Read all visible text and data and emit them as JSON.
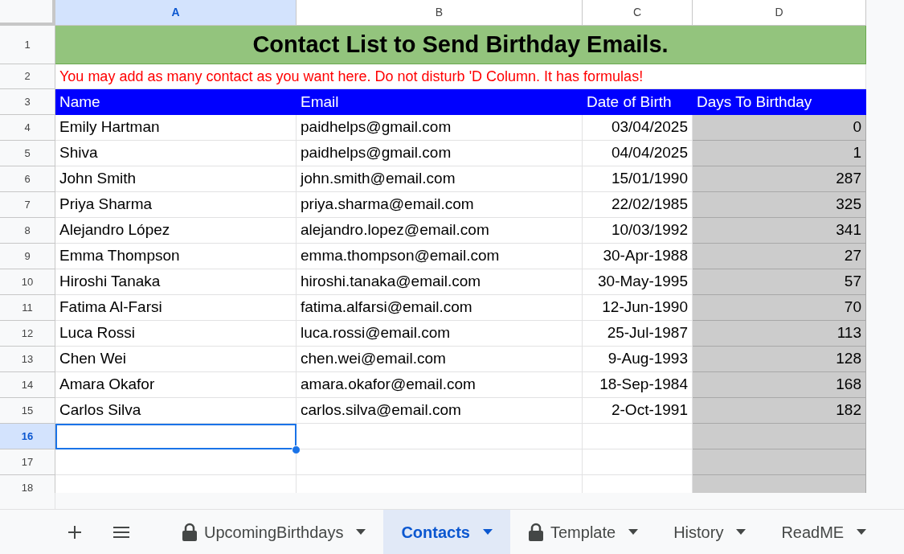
{
  "columns": [
    {
      "label": "A",
      "selected": true
    },
    {
      "label": "B",
      "selected": false
    },
    {
      "label": "C",
      "selected": false
    },
    {
      "label": "D",
      "selected": false
    }
  ],
  "title_row": {
    "number": "1",
    "text": "Contact List to Send Birthday Emails."
  },
  "note_row": {
    "number": "2",
    "text": "You may add as many contact as you want here. Do not disturb 'D Column. It has formulas!"
  },
  "header_row": {
    "number": "3",
    "cells": [
      "Name",
      "Email",
      "Date of Birth",
      "Days To Birthday"
    ]
  },
  "rows": [
    {
      "number": "4",
      "selected": false,
      "cells": [
        "Emily Hartman",
        "paidhelps@gmail.com",
        "03/04/2025",
        "0"
      ]
    },
    {
      "number": "5",
      "selected": false,
      "cells": [
        "Shiva",
        "paidhelps@gmail.com",
        "04/04/2025",
        "1"
      ]
    },
    {
      "number": "6",
      "selected": false,
      "cells": [
        "John Smith",
        "john.smith@email.com",
        "15/01/1990",
        "287"
      ]
    },
    {
      "number": "7",
      "selected": false,
      "cells": [
        "Priya Sharma",
        "priya.sharma@email.com",
        "22/02/1985",
        "325"
      ]
    },
    {
      "number": "8",
      "selected": false,
      "cells": [
        "Alejandro López",
        "alejandro.lopez@email.com",
        "10/03/1992",
        "341"
      ]
    },
    {
      "number": "9",
      "selected": false,
      "cells": [
        "Emma Thompson",
        "emma.thompson@email.com",
        "30-Apr-1988",
        "27"
      ]
    },
    {
      "number": "10",
      "selected": false,
      "cells": [
        "Hiroshi Tanaka",
        "hiroshi.tanaka@email.com",
        "30-May-1995",
        "57"
      ]
    },
    {
      "number": "11",
      "selected": false,
      "cells": [
        "Fatima Al-Farsi",
        "fatima.alfarsi@email.com",
        "12-Jun-1990",
        "70"
      ]
    },
    {
      "number": "12",
      "selected": false,
      "cells": [
        "Luca Rossi",
        "luca.rossi@email.com",
        "25-Jul-1987",
        "113"
      ]
    },
    {
      "number": "13",
      "selected": false,
      "cells": [
        "Chen Wei",
        "chen.wei@email.com",
        "9-Aug-1993",
        "128"
      ]
    },
    {
      "number": "14",
      "selected": false,
      "cells": [
        "Amara Okafor",
        "amara.okafor@email.com",
        "18-Sep-1984",
        "168"
      ]
    },
    {
      "number": "15",
      "selected": false,
      "cells": [
        "Carlos Silva",
        "carlos.silva@email.com",
        "2-Oct-1991",
        "182"
      ]
    },
    {
      "number": "16",
      "selected": true,
      "cells": []
    },
    {
      "number": "17",
      "selected": false,
      "cells": []
    },
    {
      "number": "18",
      "selected": false,
      "cells": []
    }
  ],
  "tabs": [
    {
      "label": "UpcomingBirthdays",
      "locked": true,
      "selected": false
    },
    {
      "label": "Contacts",
      "locked": false,
      "selected": true
    },
    {
      "label": "Template",
      "locked": true,
      "selected": false
    },
    {
      "label": "History",
      "locked": false,
      "selected": false
    },
    {
      "label": "ReadME",
      "locked": false,
      "selected": false
    }
  ]
}
